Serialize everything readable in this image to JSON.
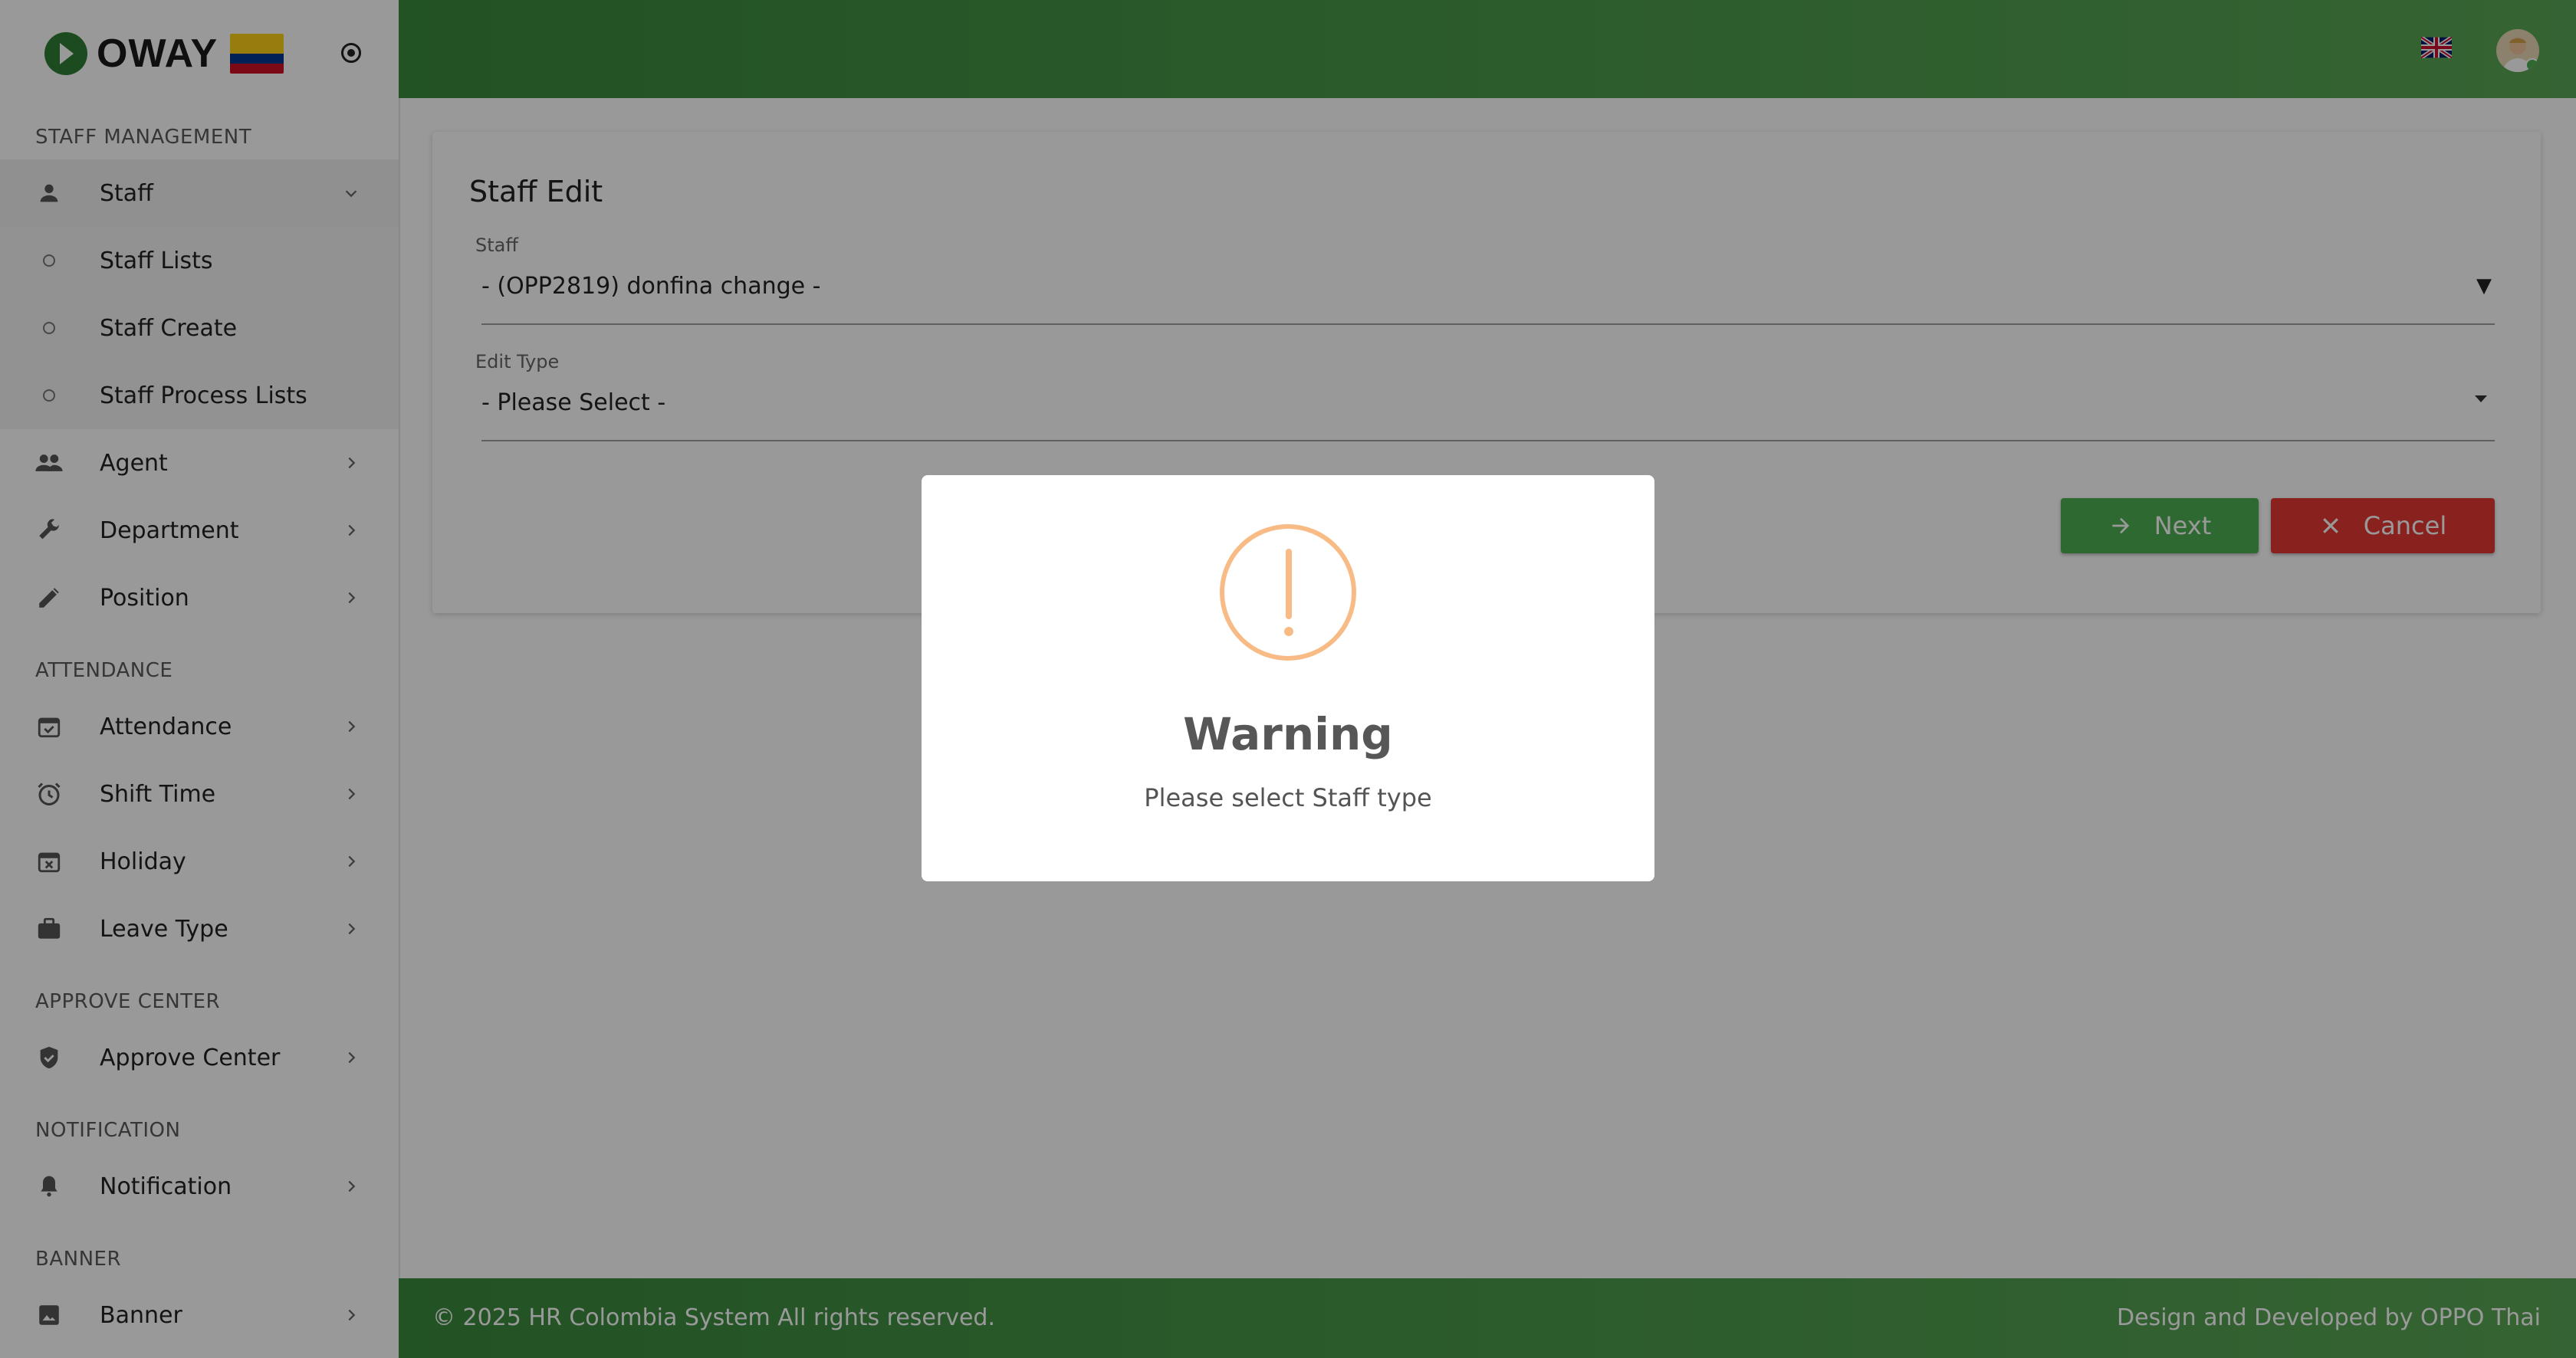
{
  "brand": {
    "logo_text": "OWAY"
  },
  "sidebar": {
    "sections": {
      "staff_management": "STAFF MANAGEMENT",
      "attendance": "ATTENDANCE",
      "approve_center": "APPROVE CENTER",
      "notification": "NOTIFICATION",
      "banner": "BANNER"
    },
    "items": {
      "staff": "Staff",
      "staff_lists": "Staff Lists",
      "staff_create": "Staff Create",
      "staff_process_lists": "Staff Process Lists",
      "agent": "Agent",
      "department": "Department",
      "position": "Position",
      "attendance": "Attendance",
      "shift_time": "Shift Time",
      "holiday": "Holiday",
      "leave_type": "Leave Type",
      "approve_center": "Approve Center",
      "notification": "Notification",
      "banner": "Banner"
    }
  },
  "form": {
    "title": "Staff Edit",
    "staff_label": "Staff",
    "staff_value": "- (OPP2819) donfina change -",
    "edit_type_label": "Edit Type",
    "edit_type_value": "- Please Select -",
    "next_label": "Next",
    "cancel_label": "Cancel"
  },
  "footer": {
    "left": "© 2025 HR Colombia System All rights reserved.",
    "right": "Design and Developed by OPPO Thai"
  },
  "modal": {
    "title": "Warning",
    "text": "Please select Staff type"
  },
  "colors": {
    "header_green": "#3a8a3e",
    "next_green": "#4caf50",
    "cancel_red": "#e53935",
    "warning_orange": "#f8bb86"
  }
}
